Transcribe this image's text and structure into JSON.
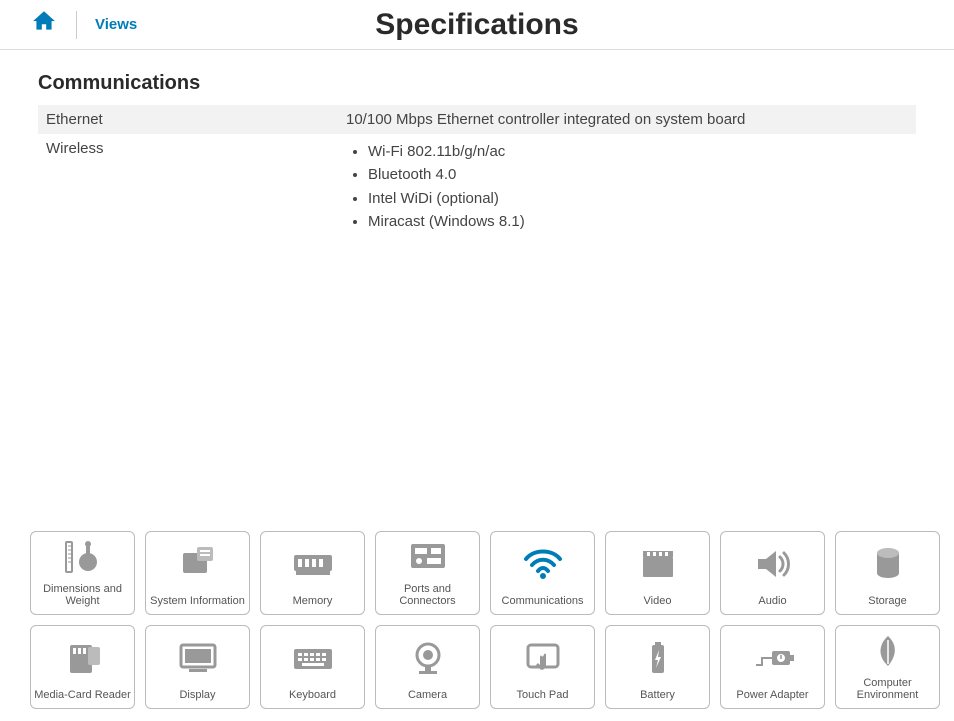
{
  "header": {
    "views_label": "Views",
    "title": "Specifications"
  },
  "section": {
    "title": "Communications",
    "rows": [
      {
        "label": "Ethernet",
        "value": "10/100 Mbps Ethernet controller integrated on system board"
      },
      {
        "label": "Wireless"
      }
    ],
    "wireless_items": [
      "Wi-Fi 802.11b/g/n/ac",
      "Bluetooth 4.0",
      "Intel WiDi (optional)",
      "Miracast (Windows 8.1)"
    ]
  },
  "nav": [
    {
      "label": "Dimensions and Weight",
      "icon": "dimensions"
    },
    {
      "label": "System Information",
      "icon": "system"
    },
    {
      "label": "Memory",
      "icon": "memory"
    },
    {
      "label": "Ports and Connectors",
      "icon": "ports"
    },
    {
      "label": "Communications",
      "icon": "wifi",
      "active": true
    },
    {
      "label": "Video",
      "icon": "video"
    },
    {
      "label": "Audio",
      "icon": "audio"
    },
    {
      "label": "Storage",
      "icon": "storage"
    },
    {
      "label": "Media-Card Reader",
      "icon": "mediacard"
    },
    {
      "label": "Display",
      "icon": "display"
    },
    {
      "label": "Keyboard",
      "icon": "keyboard"
    },
    {
      "label": "Camera",
      "icon": "camera"
    },
    {
      "label": "Touch Pad",
      "icon": "touchpad"
    },
    {
      "label": "Battery",
      "icon": "battery"
    },
    {
      "label": "Power Adapter",
      "icon": "power"
    },
    {
      "label": "Computer Environment",
      "icon": "environment"
    }
  ]
}
